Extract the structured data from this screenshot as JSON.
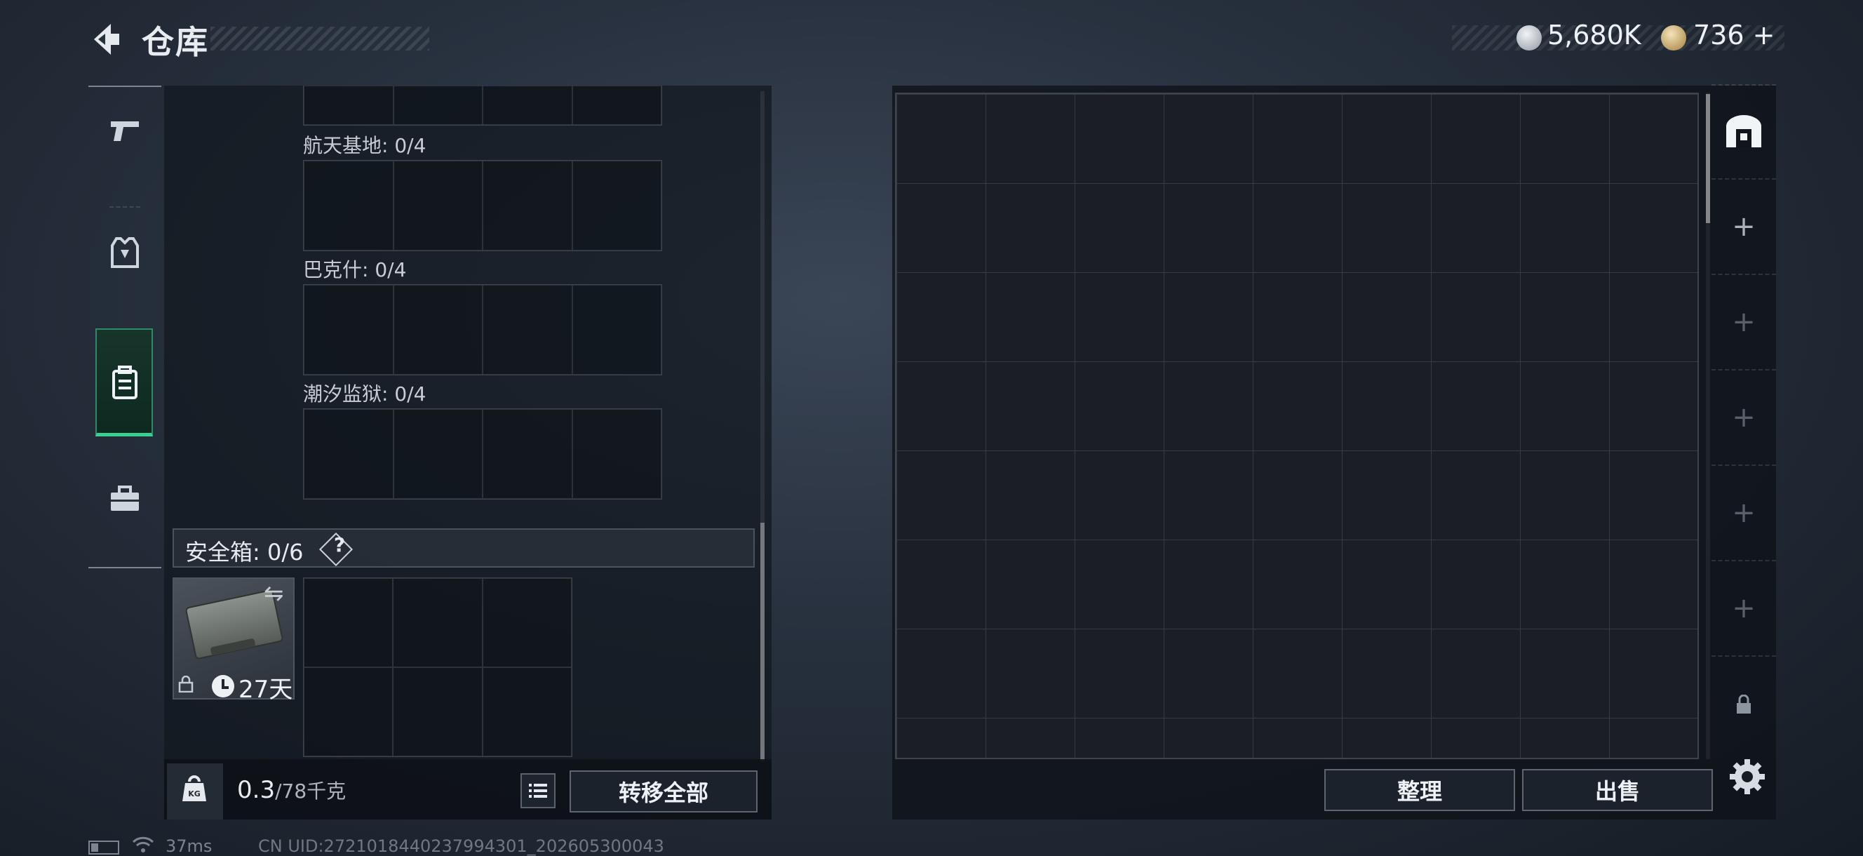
{
  "header": {
    "title": "仓库",
    "currency_silver": "5,680K",
    "currency_gold": "736",
    "add_label": "+"
  },
  "nav": {
    "items": [
      {
        "icon": "pistol-icon"
      },
      {
        "icon": "armor-vest-icon"
      },
      {
        "icon": "backpack-icon",
        "active": true
      },
      {
        "icon": "toolbox-icon"
      }
    ]
  },
  "storage": {
    "map_slots": [
      {
        "label": "航天基地: 0/4"
      },
      {
        "label": "巴克什: 0/4"
      },
      {
        "label": "潮汐监狱: 0/4"
      }
    ],
    "secure_box": {
      "label": "安全箱: 0/6",
      "help": "?",
      "days_left": "27天"
    },
    "weight_value": "0.3",
    "weight_max": "/78千克",
    "transfer_all": "转移全部"
  },
  "right_panel": {
    "side_plus": "+",
    "sort_label": "整理",
    "sell_label": "出售"
  },
  "footer": {
    "ping": "37ms",
    "uid": "CN UID:2721018440237994301_202605300043"
  },
  "colors": {
    "accent_green": "#3ad093",
    "background": "#262f3c"
  }
}
